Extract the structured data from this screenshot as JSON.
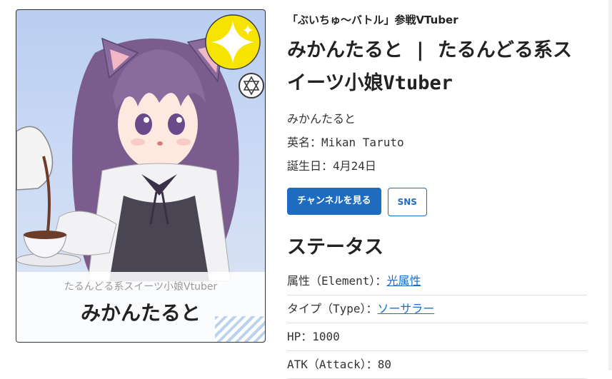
{
  "card": {
    "subtitle": "たるんどる系スイーツ小娘Vtuber",
    "name": "みかんたると",
    "attribute_icon": "light-sparkle-icon",
    "type_icon": "hexagram-icon"
  },
  "profile": {
    "eyebrow": "「ぶいちゅ〜バトル」参戦VTuber",
    "title": "みかんたると | たるんどる系スイーツ小娘Vtuber",
    "name": "みかんたると",
    "english_name": "英名：Mikan Taruto",
    "birthday": "誕生日：4月24日",
    "channel_button": "チャンネルを見る",
    "sns_button": "SNS"
  },
  "status": {
    "heading": "ステータス",
    "element_label": "属性（Element）：",
    "element_value": "光属性",
    "type_label": "タイプ（Type）：",
    "type_value": "ソーサラー",
    "hp": "HP：1000",
    "atk": "ATK（Attack）：80"
  },
  "colors": {
    "accent": "#1e6cc0",
    "badge_yellow": "#f6e400"
  }
}
